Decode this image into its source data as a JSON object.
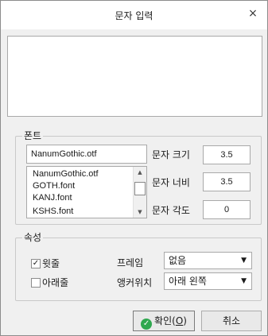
{
  "window": {
    "title": "문자 입력",
    "close_glyph": "×"
  },
  "text_input": {
    "value": ""
  },
  "font_group": {
    "label": "폰트",
    "font_value": "NanumGothic.otf",
    "font_list": [
      "NanumGothic.otf",
      "GOTH.font",
      "KANJ.font",
      "KSHS.font"
    ],
    "size_label": "문자 크기",
    "size_value": "3.5",
    "width_label": "문자 너비",
    "width_value": "3.5",
    "angle_label": "문자 각도",
    "angle_value": "0"
  },
  "attr_group": {
    "label": "속성",
    "overline_label": "윗줄",
    "overline_checked": true,
    "underline_label": "아래줄",
    "underline_checked": false,
    "frame_label": "프레임",
    "frame_value": "없음",
    "anchor_label": "앵커위치",
    "anchor_value": "아래 왼쪽"
  },
  "buttons": {
    "ok_label": "확인(",
    "ok_mnemonic": "O",
    "ok_suffix": ")",
    "cancel_label": "취소"
  },
  "colors": {
    "ok_icon": "#2fa84f",
    "background": "#f0f0f0"
  }
}
